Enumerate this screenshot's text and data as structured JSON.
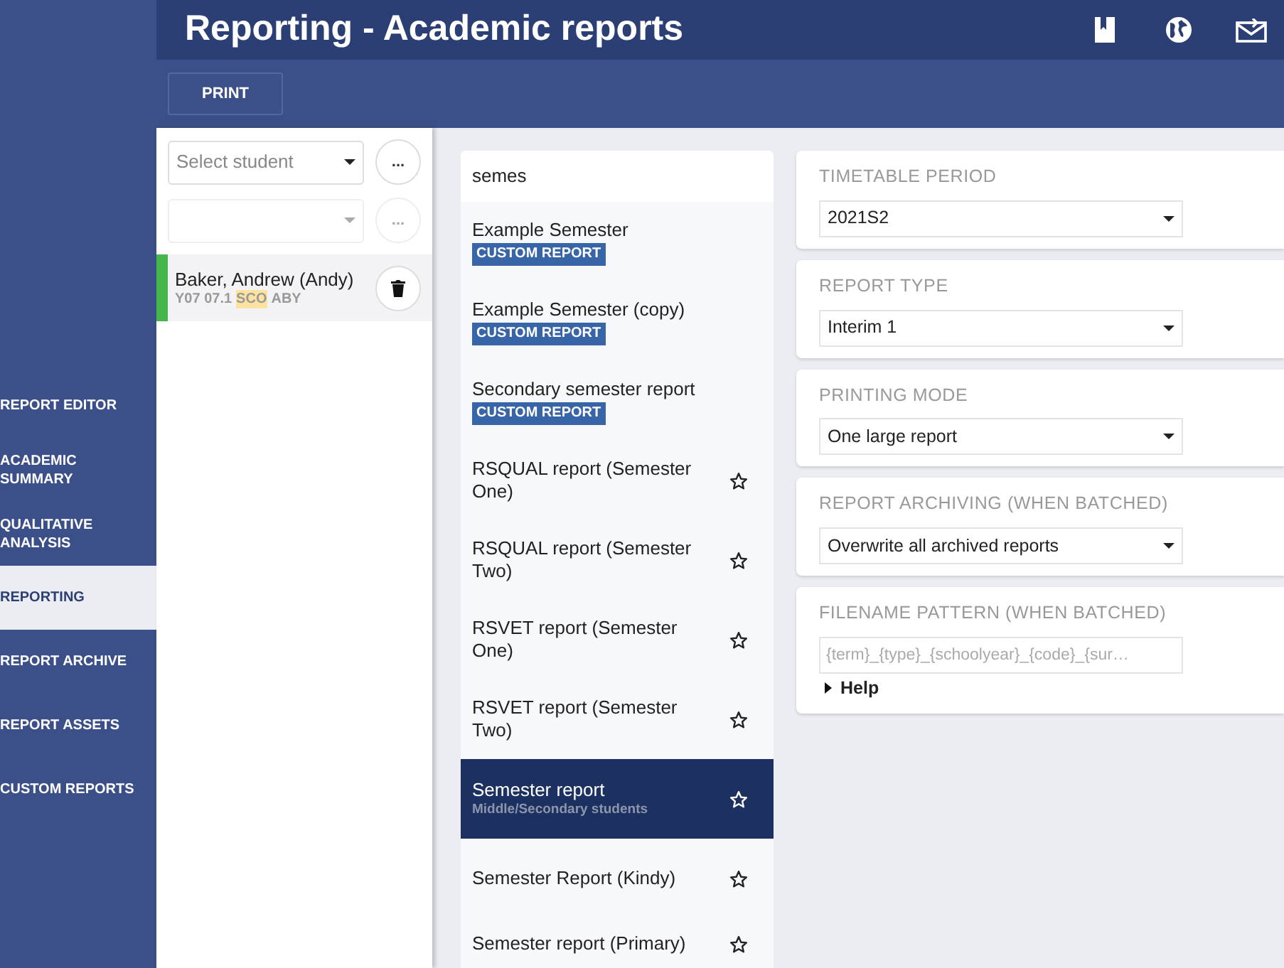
{
  "header": {
    "title": "Reporting - Academic reports"
  },
  "toolbar": {
    "buttons": [
      "PRINT"
    ]
  },
  "nav": [
    {
      "label": "REPORT EDITOR",
      "selected": false
    },
    {
      "label": "ACADEMIC SUMMARY",
      "selected": false
    },
    {
      "label": "QUALITATIVE ANALYSIS",
      "selected": false
    },
    {
      "label": "REPORTING",
      "selected": true
    },
    {
      "label": "REPORT ARCHIVE",
      "selected": false
    },
    {
      "label": "REPORT ASSETS",
      "selected": false
    },
    {
      "label": "CUSTOM REPORTS",
      "selected": false
    }
  ],
  "student_panel": {
    "selects": [
      {
        "placeholder": "Select student",
        "disabled": false,
        "more": "..."
      },
      {
        "disabled": true,
        "more": "..."
      }
    ],
    "students": [
      {
        "name": "Baker, Andrew (Andy)",
        "meta": [
          {
            "text": "Y07 07.1",
            "highlighted": false
          },
          {
            "text": "SCO",
            "highlighted": true
          },
          {
            "text": "ABY",
            "highlighted": false
          }
        ],
        "color": "#46b64a"
      }
    ]
  },
  "report_list": {
    "search": "semes",
    "items": [
      {
        "kind": "custom",
        "name": "Example Semester",
        "badge": "CUSTOM REPORT",
        "selected": false
      },
      {
        "kind": "custom",
        "name": "Example Semester (copy)",
        "badge": "CUSTOM REPORT",
        "selected": false
      },
      {
        "kind": "custom",
        "name": "Secondary semester report",
        "badge": "CUSTOM REPORT",
        "selected": false
      },
      {
        "kind": "standard",
        "name": "RSQUAL report (Semester One)",
        "selected": false,
        "starred": false
      },
      {
        "kind": "standard",
        "name": "RSQUAL report (Semester Two)",
        "selected": false,
        "starred": false
      },
      {
        "kind": "standard",
        "name": "RSVET report (Semester One)",
        "selected": false,
        "starred": false
      },
      {
        "kind": "standard",
        "name": "RSVET report (Semester Two)",
        "selected": false,
        "starred": false
      },
      {
        "kind": "standard",
        "name": "Semester report",
        "subtitle": "Middle/Secondary students",
        "selected": true,
        "starred": false
      },
      {
        "kind": "standard",
        "name": "Semester Report (Kindy)",
        "selected": false,
        "starred": false
      },
      {
        "kind": "standard",
        "name": "Semester report (Primary)",
        "selected": false,
        "starred": false
      }
    ]
  },
  "settings": [
    {
      "kind": "select",
      "label": "TIMETABLE PERIOD",
      "value": "2021S2"
    },
    {
      "kind": "select",
      "label": "REPORT TYPE",
      "value": "Interim 1"
    },
    {
      "kind": "select",
      "label": "PRINTING MODE",
      "value": "One large report"
    },
    {
      "kind": "select",
      "label": "REPORT ARCHIVING (WHEN BATCHED)",
      "value": "Overwrite all archived reports"
    },
    {
      "kind": "text",
      "label": "FILENAME PATTERN (WHEN BATCHED)",
      "placeholder": "{term}_{type}_{schoolyear}_{code}_{sur…",
      "help": "Help"
    }
  ]
}
